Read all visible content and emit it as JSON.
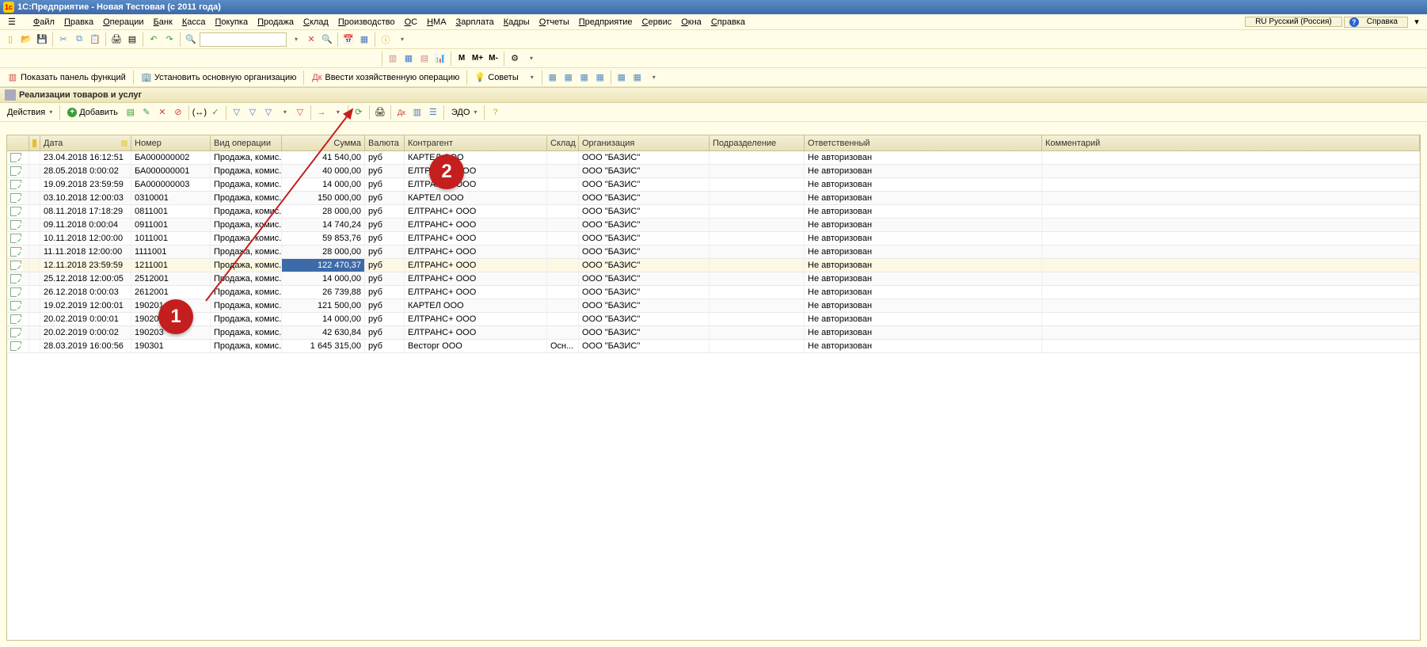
{
  "title": "1С:Предприятие - Новая Тестовая (с 2011 года)",
  "lang_tab": "RU Русский (Россия)",
  "help_tab": "Справка",
  "menu": [
    "Файл",
    "Правка",
    "Операции",
    "Банк",
    "Касса",
    "Покупка",
    "Продажа",
    "Склад",
    "Производство",
    "ОС",
    "НМА",
    "Зарплата",
    "Кадры",
    "Отчеты",
    "Предприятие",
    "Сервис",
    "Окна",
    "Справка"
  ],
  "toolbar3": {
    "show_panel": "Показать панель функций",
    "set_org": "Установить основную организацию",
    "enter_op": "Ввести хозяйственную операцию",
    "tips": "Советы"
  },
  "subheader": "Реализации товаров и услуг",
  "form_toolbar": {
    "actions": "Действия",
    "add": "Добавить",
    "edo": "ЭДО"
  },
  "m_buttons": [
    "М",
    "М+",
    "М-"
  ],
  "columns": [
    "",
    "",
    "Дата",
    "Номер",
    "Вид операции",
    "Сумма",
    "Валюта",
    "Контрагент",
    "Склад",
    "Организация",
    "Подразделение",
    "Ответственный",
    "Комментарий"
  ],
  "rows": [
    {
      "d": "23.04.2018 16:12:51",
      "n": "БА000000002",
      "op": "Продажа, комис...",
      "s": "41 540,00",
      "v": "руб",
      "k": "КАРТЕЛ ООО",
      "sk": "",
      "o": "ООО \"БАЗИС\"",
      "p": "",
      "r": "Не авторизован"
    },
    {
      "d": "28.05.2018 0:00:02",
      "n": "БА000000001",
      "op": "Продажа, комис...",
      "s": "40 000,00",
      "v": "руб",
      "k": "ЕЛТРАНС+ ООО",
      "sk": "",
      "o": "ООО \"БАЗИС\"",
      "p": "",
      "r": "Не авторизован"
    },
    {
      "d": "19.09.2018 23:59:59",
      "n": "БА000000003",
      "op": "Продажа, комис...",
      "s": "14 000,00",
      "v": "руб",
      "k": "ЕЛТРАНС+ ООО",
      "sk": "",
      "o": "ООО \"БАЗИС\"",
      "p": "",
      "r": "Не авторизован"
    },
    {
      "d": "03.10.2018 12:00:03",
      "n": "0310001",
      "op": "Продажа, комис...",
      "s": "150 000,00",
      "v": "руб",
      "k": "КАРТЕЛ ООО",
      "sk": "",
      "o": "ООО \"БАЗИС\"",
      "p": "",
      "r": "Не авторизован"
    },
    {
      "d": "08.11.2018 17:18:29",
      "n": "0811001",
      "op": "Продажа, комис...",
      "s": "28 000,00",
      "v": "руб",
      "k": "ЕЛТРАНС+ ООО",
      "sk": "",
      "o": "ООО \"БАЗИС\"",
      "p": "",
      "r": "Не авторизован"
    },
    {
      "d": "09.11.2018 0:00:04",
      "n": "0911001",
      "op": "Продажа, комис...",
      "s": "14 740,24",
      "v": "руб",
      "k": "ЕЛТРАНС+ ООО",
      "sk": "",
      "o": "ООО \"БАЗИС\"",
      "p": "",
      "r": "Не авторизован"
    },
    {
      "d": "10.11.2018 12:00:00",
      "n": "1011001",
      "op": "Продажа, комис...",
      "s": "59 853,76",
      "v": "руб",
      "k": "ЕЛТРАНС+ ООО",
      "sk": "",
      "o": "ООО \"БАЗИС\"",
      "p": "",
      "r": "Не авторизован"
    },
    {
      "d": "11.11.2018 12:00:00",
      "n": "1111001",
      "op": "Продажа, комис...",
      "s": "28 000,00",
      "v": "руб",
      "k": "ЕЛТРАНС+ ООО",
      "sk": "",
      "o": "ООО \"БАЗИС\"",
      "p": "",
      "r": "Не авторизован"
    },
    {
      "d": "12.11.2018 23:59:59",
      "n": "1211001",
      "op": "Продажа, комис...",
      "s": "122 470,37",
      "v": "руб",
      "k": "ЕЛТРАНС+ ООО",
      "sk": "",
      "o": "ООО \"БАЗИС\"",
      "p": "",
      "r": "Не авторизован",
      "sel": true
    },
    {
      "d": "25.12.2018 12:00:05",
      "n": "2512001",
      "op": "Продажа, комис...",
      "s": "14 000,00",
      "v": "руб",
      "k": "ЕЛТРАНС+ ООО",
      "sk": "",
      "o": "ООО \"БАЗИС\"",
      "p": "",
      "r": "Не авторизован"
    },
    {
      "d": "26.12.2018 0:00:03",
      "n": "2612001",
      "op": "Продажа, комис...",
      "s": "26 739,88",
      "v": "руб",
      "k": "ЕЛТРАНС+ ООО",
      "sk": "",
      "o": "ООО \"БАЗИС\"",
      "p": "",
      "r": "Не авторизован"
    },
    {
      "d": "19.02.2019 12:00:01",
      "n": "190201",
      "op": "Продажа, комис...",
      "s": "121 500,00",
      "v": "руб",
      "k": "КАРТЕЛ ООО",
      "sk": "",
      "o": "ООО \"БАЗИС\"",
      "p": "",
      "r": "Не авторизован"
    },
    {
      "d": "20.02.2019 0:00:01",
      "n": "190202",
      "op": "Продажа, комис...",
      "s": "14 000,00",
      "v": "руб",
      "k": "ЕЛТРАНС+ ООО",
      "sk": "",
      "o": "ООО \"БАЗИС\"",
      "p": "",
      "r": "Не авторизован"
    },
    {
      "d": "20.02.2019 0:00:02",
      "n": "190203",
      "op": "Продажа, комис...",
      "s": "42 630,84",
      "v": "руб",
      "k": "ЕЛТРАНС+ ООО",
      "sk": "",
      "o": "ООО \"БАЗИС\"",
      "p": "",
      "r": "Не авторизован"
    },
    {
      "d": "28.03.2019 16:00:56",
      "n": "190301",
      "op": "Продажа, комис...",
      "s": "1 645 315,00",
      "v": "руб",
      "k": "Весторг ООО",
      "sk": "Осн...",
      "o": "ООО \"БАЗИС\"",
      "p": "",
      "r": "Не авторизован"
    }
  ],
  "annotations": {
    "a1": "1",
    "a2": "2"
  }
}
